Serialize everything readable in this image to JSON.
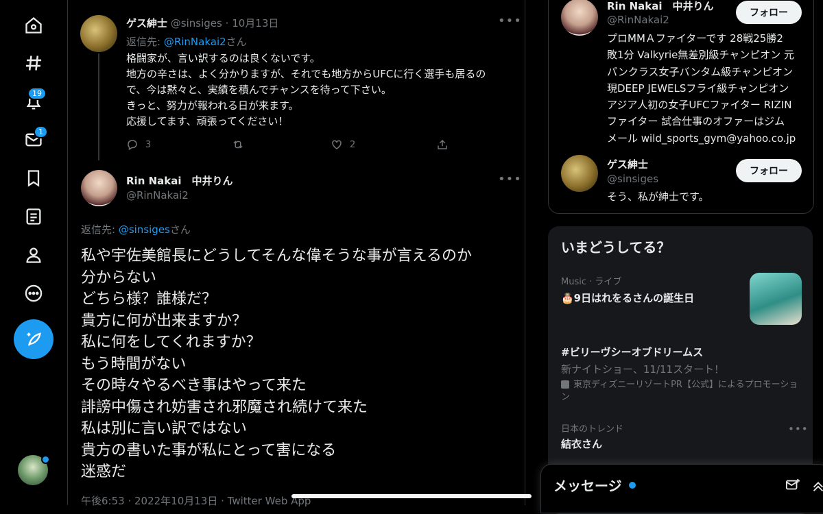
{
  "nav": {
    "notifications_badge": "19",
    "messages_badge": "1"
  },
  "reply_tweet": {
    "author_name": "ゲス紳士",
    "author_handle": "@sinsiges",
    "separator": "·",
    "date": "10月13日",
    "reply_to_prefix": "返信先: ",
    "reply_to_handle": "@RinNakai2",
    "reply_to_suffix": "さん",
    "lines": [
      "格闘家が、言い訳するのは良くないです。",
      "地方の辛さは、よく分かりますが、それでも地方からUFCに行く選手も居るの",
      "で、今は黙々と、実績を積んでチャンスを待って下さい。",
      "きっと、努力が報われる日が来ます。",
      "応援してます、頑張ってください！"
    ],
    "reply_count": "3",
    "retweet_count": "",
    "like_count": "2"
  },
  "main_tweet": {
    "author_name": "Rin Nakai　中井りん",
    "author_handle": "@RinNakai2",
    "reply_to_prefix": "返信先: ",
    "reply_to_handle": "@sinsiges",
    "reply_to_suffix": "さん",
    "lines": [
      "私や宇佐美館長にどうしてそんな偉そうな事が言えるのか",
      "分からない",
      "どちら様？誰様だ？",
      "貴方に何が出来ますか？",
      "私に何をしてくれますか？",
      "もう時間がない",
      "その時々やるべき事はやって来た",
      "誹謗中傷され妨害され邪魔され続けて来た",
      "私は別に言い訳ではない",
      "貴方の書いた事が私にとって害になる",
      "迷惑だ"
    ],
    "timestamp": "午後6:53 · 2022年10月13日 · Twitter Web App"
  },
  "relevant_people": [
    {
      "name": "Rin Nakai　中井りん",
      "handle": "@RinNakai2",
      "follow_label": "フォロー",
      "bio_lines": [
        "プロMMＡファイターです 28戦25勝2",
        "敗1分 Valkyrie無差別級チャンピオン 元",
        "パンクラス女子バンタム級チャンピオン",
        "現DEEP JEWELSフライ級チャンピオン",
        "アジア人初の女子UFCファイター RIZIN",
        "ファイター 試合仕事のオファーはジム",
        "メール wild_sports_gym@yahoo.co.jp"
      ]
    },
    {
      "name": "ゲス紳士",
      "handle": "@sinsiges",
      "follow_label": "フォロー",
      "bio_lines": [
        "そう、私が紳士です。"
      ]
    }
  ],
  "trends": {
    "title": "いまどうしてる？",
    "items": [
      {
        "context": "Music · ライブ",
        "title": "🎂9日はれをるさんの誕生日"
      },
      {
        "title": "#ビリーヴシーオブドリームス",
        "subtitle": "新ナイトショー、11/11スタート！",
        "promo": "東京ディズニーリゾートPR【公式】によるプロモーション"
      },
      {
        "context": "日本のトレンド",
        "title": "結衣さん"
      }
    ]
  },
  "messages": {
    "title": "メッセージ"
  },
  "colors": {
    "accent": "#1d9bf0",
    "background": "#000000",
    "panel": "#16181c",
    "muted_text": "#71767b"
  }
}
